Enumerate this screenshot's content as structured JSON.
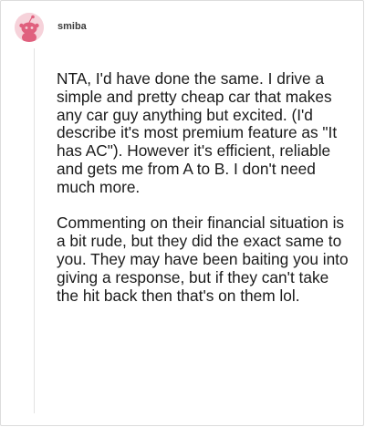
{
  "comment": {
    "username": "smiba",
    "avatar_icon": "pink-reddit-snoo-avatar-icon",
    "paragraphs": [
      "NTA, I'd have done the same. I drive a simple and pretty cheap car that makes any car guy anything but excited. (I'd describe it's most premium feature as \"It has AC\"). However it's efficient, reliable and gets me from A to B. I don't need much more.",
      "Commenting on their financial situation is a bit rude, but they did the exact same to you. They may have been baiting you into giving a response, but if they can't take the hit back then that's on them lol."
    ]
  },
  "colors": {
    "avatar_background": "#f6d2da",
    "avatar_figure": "#e0607e",
    "thread_line": "#e2e2e2",
    "username_text": "#3a3a3a",
    "body_text": "#1a1a1a"
  }
}
